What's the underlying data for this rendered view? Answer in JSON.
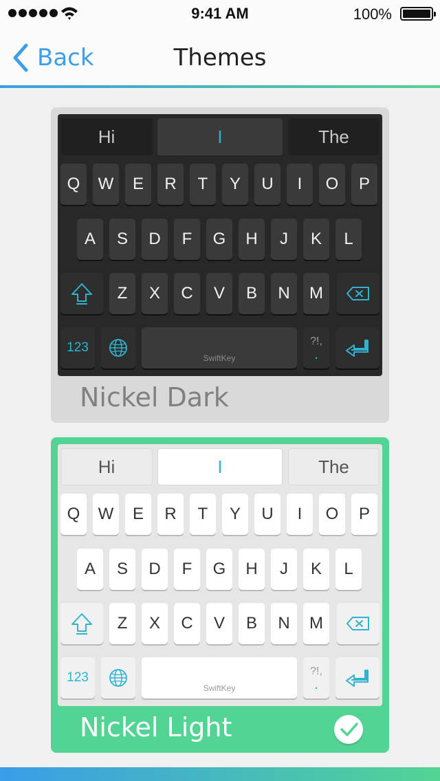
{
  "status_bar": {
    "time": "9:41 AM",
    "battery": "100%"
  },
  "nav": {
    "back_label": "Back",
    "title": "Themes"
  },
  "themes": [
    {
      "name": "Nickel Dark",
      "selected": false,
      "predictions": [
        "Hi",
        "I",
        "The"
      ],
      "row1": [
        "Q",
        "W",
        "E",
        "R",
        "T",
        "Y",
        "U",
        "I",
        "O",
        "P"
      ],
      "row2": [
        "A",
        "S",
        "D",
        "F",
        "G",
        "H",
        "J",
        "K",
        "L"
      ],
      "row3": [
        "Z",
        "X",
        "C",
        "V",
        "B",
        "N",
        "M"
      ],
      "numbers_key": "123",
      "symbols_key_top": "?!,",
      "symbols_key_bottom": ".",
      "space_brand": "SwiftKey"
    },
    {
      "name": "Nickel Light",
      "selected": true,
      "predictions": [
        "Hi",
        "I",
        "The"
      ],
      "row1": [
        "Q",
        "W",
        "E",
        "R",
        "T",
        "Y",
        "U",
        "I",
        "O",
        "P"
      ],
      "row2": [
        "A",
        "S",
        "D",
        "F",
        "G",
        "H",
        "J",
        "K",
        "L"
      ],
      "row3": [
        "Z",
        "X",
        "C",
        "V",
        "B",
        "N",
        "M"
      ],
      "numbers_key": "123",
      "symbols_key_top": "?!,",
      "symbols_key_bottom": ".",
      "space_brand": "SwiftKey"
    }
  ],
  "colors": {
    "accent_blue": "#3d9fe8",
    "selected_green": "#52d494",
    "key_icon_teal": "#2fb3d1"
  }
}
